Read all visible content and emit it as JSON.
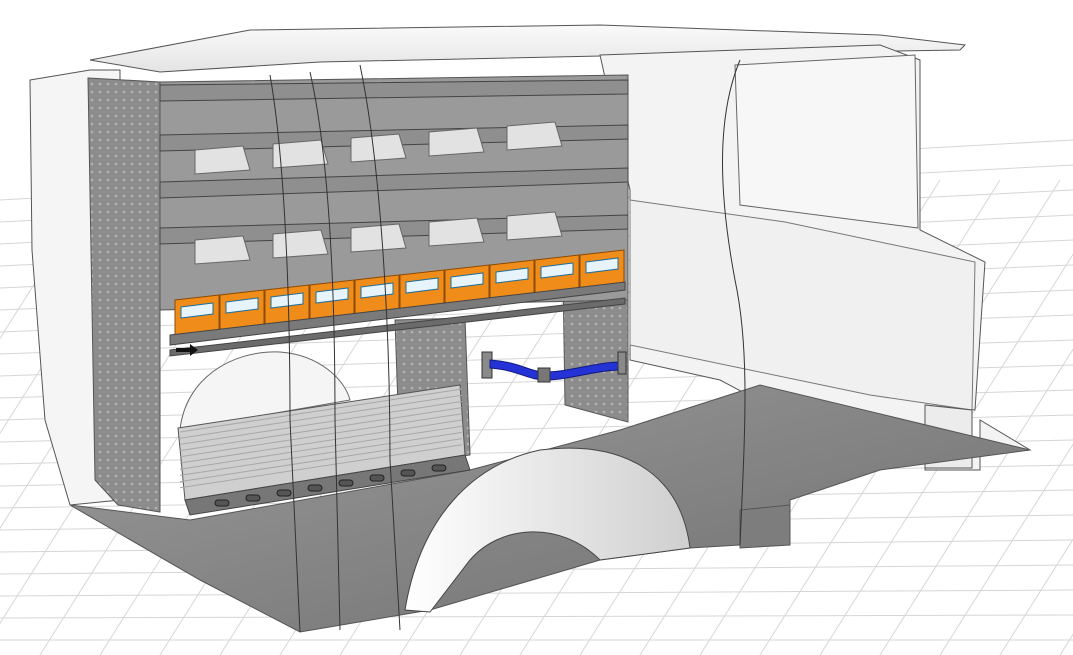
{
  "scene": {
    "description_visible_text": "",
    "colors": {
      "background": "#ffffff",
      "grid_line": "#d6d6d6",
      "van_shell": "#f2f2f2",
      "van_outline": "#444444",
      "shelf_metal": "#8f8f8f",
      "shelf_dark": "#6e6e6e",
      "floor": "#8a8a8a",
      "bin_orange": "#f08c1a",
      "bin_label": "#e8f4fb",
      "strap_blue": "#2433d6",
      "drawer_panel": "#c9c9c9"
    },
    "shelving": {
      "shelf_levels": 4,
      "dividers_per_shelf": 5,
      "bin_count": 10,
      "drawer_slots": 8
    },
    "icons": [
      "arrow-right-icon"
    ]
  }
}
